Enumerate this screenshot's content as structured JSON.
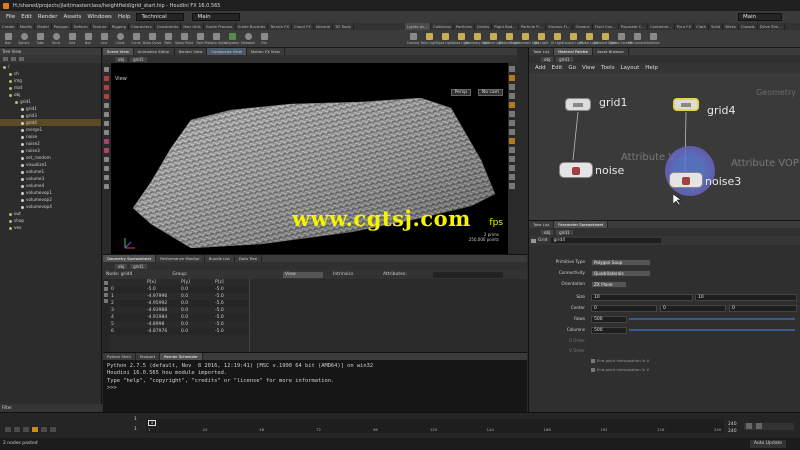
{
  "window": {
    "title": "H:/shared/projects/jlait/masterclass/heightfield/grid_start.hip - Houdini FX 16.0.565",
    "menus": [
      "File",
      "Edit",
      "Render",
      "Assets",
      "Windows",
      "Help"
    ],
    "desktop_left": "Technical",
    "desktop_main": "Main",
    "desktop_right": "Main"
  },
  "shelf_tabs_left": [
    "Create",
    "Modify",
    "Model",
    "Polygon",
    "Deform",
    "Texture",
    "Rigging",
    "Characters",
    "Constraints",
    "Hair Utils",
    "Guide Process",
    "Guide Brushes",
    "Terrain FX",
    "Cloud FX",
    "Volume",
    "TD Tools"
  ],
  "shelf_tools_left": [
    "Box",
    "Sphere",
    "Tube",
    "Torus",
    "Grid",
    "Null",
    "Line",
    "Circle",
    "Curve",
    "Draw Curve",
    "Path",
    "Spray Paint",
    "Font",
    "Platonic Solids",
    "L-System",
    "Metaball",
    "File"
  ],
  "shelf_tabs_right": [
    "Lights an...",
    "Collisions",
    "Particles",
    "Grains",
    "Rigid Bod...",
    "Particle Fl...",
    "Viscous Fl...",
    "Oceans",
    "Fluid Con...",
    "Populate C...",
    "Container...",
    "Pyro FX",
    "Cloth",
    "Solid",
    "Wires",
    "Crowds",
    "Drive Sim..."
  ],
  "shelf_tools_right": [
    "Camera",
    "Point Light",
    "Spot Light",
    "Area Light",
    "Geometry Light",
    "Volume Light",
    "Distant Light",
    "Environment Light",
    "Sky Light",
    "GI Light",
    "Caustic Light",
    "Portal Light",
    "Ambient Light",
    "Stereo Camera",
    "VR Camera",
    "Switcher"
  ],
  "tree_view": {
    "header": "Tree View",
    "items": [
      {
        "label": "/",
        "depth": 0
      },
      {
        "label": "ch",
        "depth": 1
      },
      {
        "label": "img",
        "depth": 1
      },
      {
        "label": "mat",
        "depth": 1
      },
      {
        "label": "obj",
        "depth": 1
      },
      {
        "label": "grid1",
        "depth": 2
      },
      {
        "label": "grid1",
        "depth": 3
      },
      {
        "label": "grid3",
        "depth": 3
      },
      {
        "label": "grid4",
        "depth": 3,
        "selected": true
      },
      {
        "label": "merge1",
        "depth": 3
      },
      {
        "label": "noise",
        "depth": 3
      },
      {
        "label": "noise2",
        "depth": 3
      },
      {
        "label": "noise3",
        "depth": 3
      },
      {
        "label": "set_random",
        "depth": 3
      },
      {
        "label": "visualize1",
        "depth": 3
      },
      {
        "label": "volume1",
        "depth": 3
      },
      {
        "label": "volume3",
        "depth": 3
      },
      {
        "label": "volume4",
        "depth": 3
      },
      {
        "label": "volumevop1",
        "depth": 3
      },
      {
        "label": "volumevop2",
        "depth": 3
      },
      {
        "label": "volumevop4",
        "depth": 3
      },
      {
        "label": "out",
        "depth": 1
      },
      {
        "label": "shop",
        "depth": 1
      },
      {
        "label": "vex",
        "depth": 1
      }
    ],
    "filter_label": "Filter"
  },
  "viewport": {
    "tabs": [
      "Scene View",
      "Animation Editor",
      "Render View",
      "Composite View",
      "Motion FX View"
    ],
    "active_tab": "Scene View",
    "path": [
      "obj",
      "grid1"
    ],
    "title": "View",
    "persp": "Persp",
    "cam": "No cam",
    "stats_prims": "2 prims",
    "stats_points": "250,000 points",
    "stats_fps": "fps"
  },
  "watermark": "www.cgtsj.com",
  "spreadsheet": {
    "tabs": [
      "Geometry Spreadsheet",
      "Performance Monitor",
      "Bundle List",
      "Data Tree"
    ],
    "active_tab": "Geometry Spreadsheet",
    "path": [
      "obj",
      "grid1"
    ],
    "node_label": "Node: grid4",
    "group_label": "Group:",
    "view_label": "View",
    "intrinsics_label": "Intrinsics",
    "attributes_label": "Attributes:",
    "columns": [
      "",
      "P[x]",
      "P[y]",
      "P[z]"
    ],
    "rows": [
      [
        "0",
        "-5.0",
        "0.0",
        "-5.0"
      ],
      [
        "1",
        "-4.97996",
        "0.0",
        "-5.0"
      ],
      [
        "2",
        "-4.95992",
        "0.0",
        "-5.0"
      ],
      [
        "3",
        "-4.93988",
        "0.0",
        "-5.0"
      ],
      [
        "4",
        "-4.91984",
        "0.0",
        "-5.0"
      ],
      [
        "5",
        "-4.8998",
        "0.0",
        "-5.0"
      ],
      [
        "6",
        "-4.87976",
        "0.0",
        "-5.0"
      ]
    ]
  },
  "python": {
    "tabs": [
      "Python Shell",
      "Textport",
      "Render Scheduler"
    ],
    "active_tab": "Python Shell",
    "line1": "Python 2.7.5 (default, Nov  8 2016, 12:19:41) [MSC v.1900 64 bit (AMD64)] on win32",
    "line2": "Houdini 16.0.565 hou module imported.",
    "line3": "Type \"help\", \"copyright\", \"credits\" or \"license\" for more information.",
    "line4": ">>>"
  },
  "network": {
    "tabs": [
      "Take List",
      "Material Palette",
      "Asset Browser"
    ],
    "active_tab": "Material Palette",
    "path": [
      "obj",
      "grid1"
    ],
    "menus": [
      "Add",
      "Edit",
      "Go",
      "View",
      "Tools",
      "Layout",
      "Help"
    ],
    "context_label": "Geometry",
    "nodes": {
      "grid1": "grid1",
      "grid4": "grid4",
      "noise": "noise",
      "noise3": "noise3",
      "ghost1": "Attribute V",
      "ghost2": "Attribute VOP"
    }
  },
  "params": {
    "tabs": [
      "Take List",
      "Parameter Spreadsheet"
    ],
    "path": [
      "obj",
      "grid1"
    ],
    "node_type": "Grid",
    "node_name": "grid4",
    "primitive_type_label": "Primitive Type",
    "primitive_type_value": "Polygon Soup",
    "connectivity_label": "Connectivity",
    "connectivity_value": "Quadrilaterals",
    "orientation_label": "Orientation",
    "orientation_value": "ZX Plane",
    "size_label": "Size",
    "size_x": "10",
    "size_y": "10",
    "center_label": "Center",
    "center_x": "0",
    "center_y": "0",
    "center_z": "0",
    "rows_label": "Rows",
    "rows_value": "500",
    "rows_fraction": 0.5,
    "columns_label": "Columns",
    "columns_value": "500",
    "columns_fraction": 0.5,
    "uorder_label": "U Order",
    "vorder_label": "V Order",
    "check1": "End-point interpolation in U",
    "check2": "End-point interpolation in V"
  },
  "timeline": {
    "frame": "1",
    "start": "1",
    "end": "240",
    "end2": "240",
    "ticks": [
      "1",
      "24",
      "48",
      "72",
      "96",
      "120",
      "144",
      "168",
      "192",
      "216",
      "240"
    ],
    "auto_update": "Auto Update"
  },
  "status": {
    "text": "2 nodes pasted"
  }
}
